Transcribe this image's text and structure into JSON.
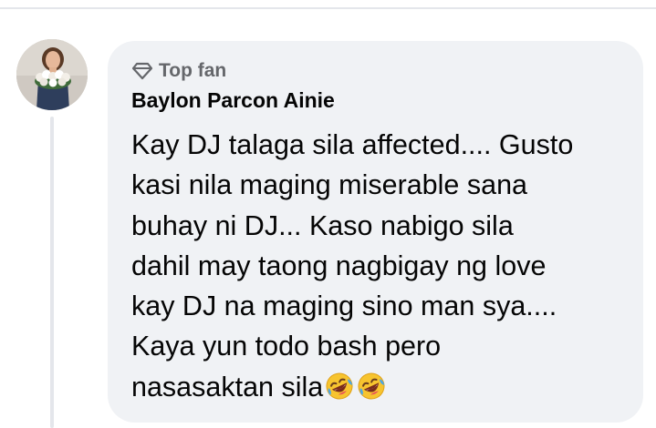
{
  "comment": {
    "badge_label": "Top fan",
    "badge_icon": "diamond-icon",
    "author": "Baylon Parcon Ainie",
    "lines": [
      "Kay DJ talaga sila affected.... Gusto",
      "kasi nila maging miserable sana",
      "buhay ni DJ... Kaso nabigo sila",
      "dahil may taong nagbigay ng love",
      "kay DJ na maging sino man sya....",
      "Kaya yun todo bash pero",
      "nasasaktan sila"
    ],
    "trailing_emojis": [
      "rolling-on-floor-laughing-emoji",
      "rolling-on-floor-laughing-emoji"
    ]
  },
  "colors": {
    "bubble_background": "#f0f2f5",
    "secondary_text": "#65676b",
    "primary_text": "#050505",
    "divider": "#e4e6eb"
  }
}
